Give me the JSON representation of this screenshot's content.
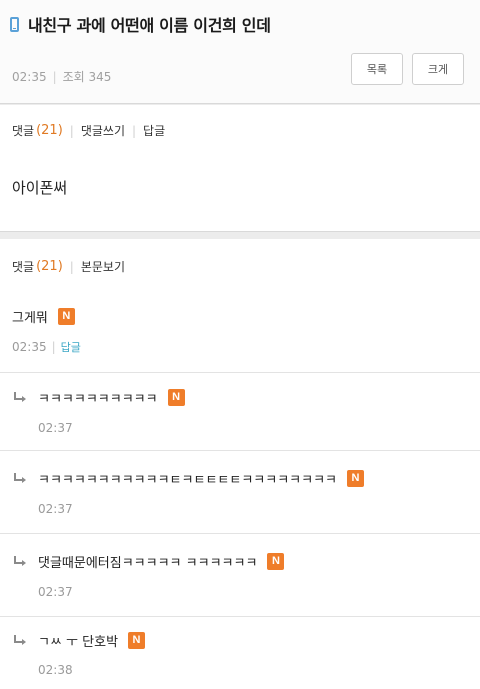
{
  "post": {
    "title": "내친구 과에 어떤애 이름 이건희 인데",
    "time": "02:35",
    "views": "조회 345",
    "buttons": {
      "list": "목록",
      "size": "크게"
    },
    "comment_bar": {
      "label": "댓글",
      "count": "(21)",
      "write": "댓글쓰기",
      "reply": "답글"
    },
    "content": "아이폰써"
  },
  "comments": {
    "bar": {
      "label": "댓글",
      "count": "(21)",
      "view_post": "본문보기"
    },
    "items": [
      {
        "text": "그게뭐",
        "badge": "N",
        "time": "02:35",
        "reply": "답글"
      },
      {
        "text": "ㅋㅋㅋㅋㅋㅋㅋㅋㅋㅋ",
        "badge": "N",
        "time": "02:37"
      },
      {
        "text": "ㅋㅋㅋㅋㅋㅋㅋㅋㅋㅋㅋㅌㅋㅌㅌㅌㅌㅋㅋㅋㅋㅋㅋㅋㅋ",
        "badge": "N",
        "time": "02:37"
      },
      {
        "text": "댓글때문에터짐ㅋㅋㅋㅋㅋ ㅋㅋㅋㅋㅋㅋ",
        "badge": "N",
        "time": "02:37"
      },
      {
        "text": "ㄱㅆ ㅜ 단호박",
        "badge": "N",
        "time": "02:38"
      }
    ]
  },
  "colors": {
    "accent_orange": "#ef7d2a",
    "count_orange": "#e07a24",
    "reply_blue": "#3aa6c5",
    "phone_icon": "#5aa1d8"
  },
  "icons": {
    "title_icon": "mobile-phone-icon",
    "reply_icon": "reply-arrow-icon"
  }
}
